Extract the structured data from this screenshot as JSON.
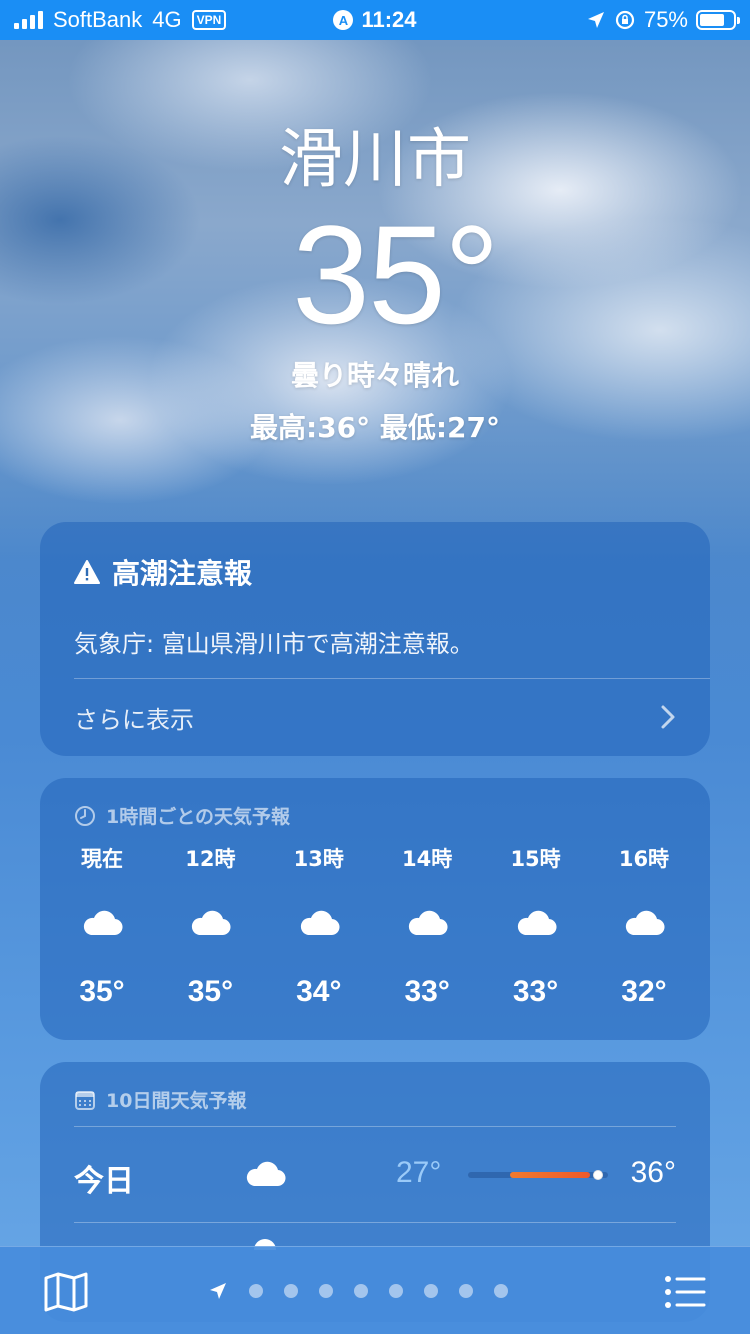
{
  "status_bar": {
    "carrier": "SoftBank",
    "network": "4G",
    "vpn": "VPN",
    "time": "11:24",
    "battery": "75%",
    "battery_level": 0.75
  },
  "header": {
    "city": "滑川市",
    "temperature": "35°",
    "condition": "曇り時々晴れ",
    "high_low": "最高:36°  最低:27°"
  },
  "alert": {
    "title": "高潮注意報",
    "body": "気象庁: 富山県滑川市で高潮注意報。",
    "more": "さらに表示",
    "icon": "warning-triangle-icon"
  },
  "hourly": {
    "title": "1時間ごとの天気予報",
    "icon": "clock-icon",
    "hours": [
      {
        "label": "現在",
        "temp": "35°",
        "icon": "cloud-icon"
      },
      {
        "label": "12時",
        "temp": "35°",
        "icon": "cloud-icon"
      },
      {
        "label": "13時",
        "temp": "34°",
        "icon": "cloud-icon"
      },
      {
        "label": "14時",
        "temp": "33°",
        "icon": "cloud-icon"
      },
      {
        "label": "15時",
        "temp": "33°",
        "icon": "cloud-icon"
      },
      {
        "label": "16時",
        "temp": "32°",
        "icon": "cloud-icon"
      }
    ]
  },
  "daily": {
    "title": "10日間天気予報",
    "icon": "calendar-icon",
    "days": [
      {
        "name": "今日",
        "low": "27°",
        "high": "36°",
        "icon": "cloud-icon",
        "range_start": 0.3,
        "range_end": 0.87,
        "current": 0.93
      }
    ]
  },
  "bottom_bar": {
    "page_count": 9,
    "active_page": 0
  },
  "colors": {
    "status_bar": "#1a8ef5",
    "card_bg": "rgba(35,100,185,0.55)",
    "range_fill": "#f07a2e",
    "low_temp": "#aad7ff"
  }
}
